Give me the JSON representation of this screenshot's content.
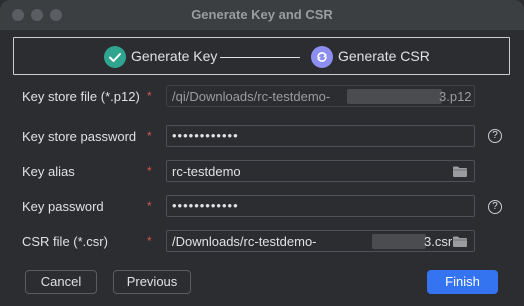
{
  "window": {
    "title": "Generate Key and CSR"
  },
  "steps": [
    {
      "label": "Generate Key",
      "icon": "checkmark-icon",
      "status": "done"
    },
    {
      "label": "Generate CSR",
      "icon": "sync-icon",
      "status": "current"
    }
  ],
  "form": {
    "keystore_file": {
      "label": "Key store file (*.p12)",
      "required": "*",
      "value_prefix": "‎/qi/Downloads/rc-testdemo-",
      "value_suffix": "3.p12"
    },
    "keystore_password": {
      "label": "Key store password",
      "required": "*",
      "value": "••••••••••••",
      "help": "?"
    },
    "key_alias": {
      "label": "Key alias",
      "required": "*",
      "value": "rc-testdemo",
      "icon": "folder-icon"
    },
    "key_password": {
      "label": "Key password",
      "required": "*",
      "value": "••••••••••••",
      "help": "?"
    },
    "csr_file": {
      "label": "CSR file (*.csr)",
      "required": "*",
      "value_prefix": "/Downloads/rc-testdemo-",
      "value_suffix": "3.csr",
      "icon": "folder-icon"
    }
  },
  "buttons": {
    "cancel": "Cancel",
    "previous": "Previous",
    "finish": "Finish"
  },
  "colors": {
    "accent": "#3574f0",
    "step_done": "#2fa58f",
    "step_current": "#8c8ff0",
    "required": "#d9534f"
  }
}
